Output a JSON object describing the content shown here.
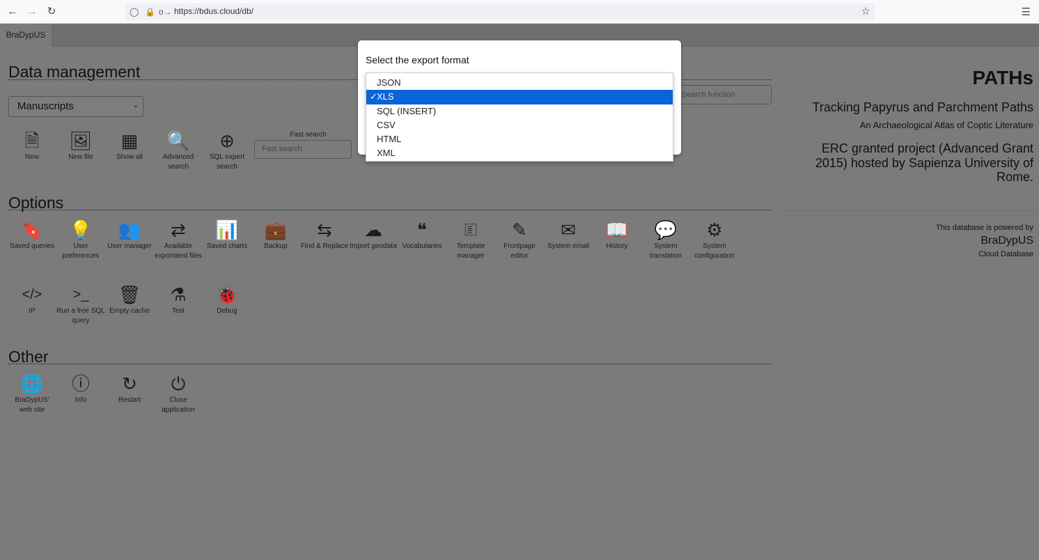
{
  "browser": {
    "url": "https://bdus.cloud/db/"
  },
  "app": {
    "tab_label": "BraDypUS"
  },
  "data_management": {
    "title": "Data management",
    "table_select": "Manuscripts",
    "items": [
      {
        "label": "New",
        "icon": "file-icon"
      },
      {
        "label": "New file",
        "icon": "image-icon"
      },
      {
        "label": "Show all",
        "icon": "table-icon"
      },
      {
        "label": "Advanced search",
        "icon": "search-icon"
      },
      {
        "label": "SQL expert search",
        "icon": "zoom-in-icon"
      }
    ],
    "fast_search_label": "Fast search",
    "fast_search_placeholder": "Fast search",
    "search_function_placeholder": "Search function"
  },
  "options": {
    "title": "Options",
    "row1": [
      {
        "label": "Saved queries",
        "icon": "bookmark-icon"
      },
      {
        "label": "User preferences",
        "icon": "lightbulb-icon"
      },
      {
        "label": "User manager",
        "icon": "users-icon"
      },
      {
        "label": "Available exportated files",
        "icon": "shuffle-icon"
      },
      {
        "label": "Saved charts",
        "icon": "bar-chart-icon"
      },
      {
        "label": "Backup",
        "icon": "briefcase-icon"
      },
      {
        "label": "Find & Replace",
        "icon": "exchange-icon"
      },
      {
        "label": "Import geodata",
        "icon": "cloud-upload-icon"
      },
      {
        "label": "Vocabularies",
        "icon": "quote-icon"
      },
      {
        "label": "Template manager",
        "icon": "id-card-icon"
      },
      {
        "label": "Frontpage editor",
        "icon": "edit-icon"
      },
      {
        "label": "System email",
        "icon": "envelope-icon"
      },
      {
        "label": "History",
        "icon": "book-icon"
      },
      {
        "label": "System translation",
        "icon": "comment-icon"
      },
      {
        "label": "System configuration",
        "icon": "gear-icon"
      }
    ],
    "row2": [
      {
        "label": "IP",
        "icon": "code-icon"
      },
      {
        "label": "Run a free SQL query",
        "icon": "terminal-icon"
      },
      {
        "label": "Empty cache",
        "icon": "trash-icon"
      },
      {
        "label": "Test",
        "icon": "flask-icon"
      },
      {
        "label": "Debug",
        "icon": "bug-icon"
      }
    ]
  },
  "other": {
    "title": "Other",
    "items": [
      {
        "label": "BraDypUS' web site",
        "icon": "globe-icon"
      },
      {
        "label": "Info",
        "icon": "info-icon"
      },
      {
        "label": "Restart",
        "icon": "refresh-icon"
      },
      {
        "label": "Close application",
        "icon": "power-icon"
      }
    ]
  },
  "right_panel": {
    "title": "PATHs",
    "subtitle": "Tracking Papyrus and Parchment Paths",
    "tagline": "An Archaeological Atlas of Coptic Literature",
    "description": "ERC granted project (Advanced Grant 2015) hosted by Sapienza University of Rome.",
    "powered_by": "This database is powered by",
    "brand": "BraDypUS",
    "brand_sub": "Cloud Database"
  },
  "modal": {
    "title": "Select the export format",
    "options": [
      "JSON",
      "XLS",
      "SQL (INSERT)",
      "CSV",
      "HTML",
      "XML"
    ],
    "selected": "XLS"
  },
  "colors": {
    "overlay": "#7b7b7b",
    "selection": "#0a63d8"
  }
}
